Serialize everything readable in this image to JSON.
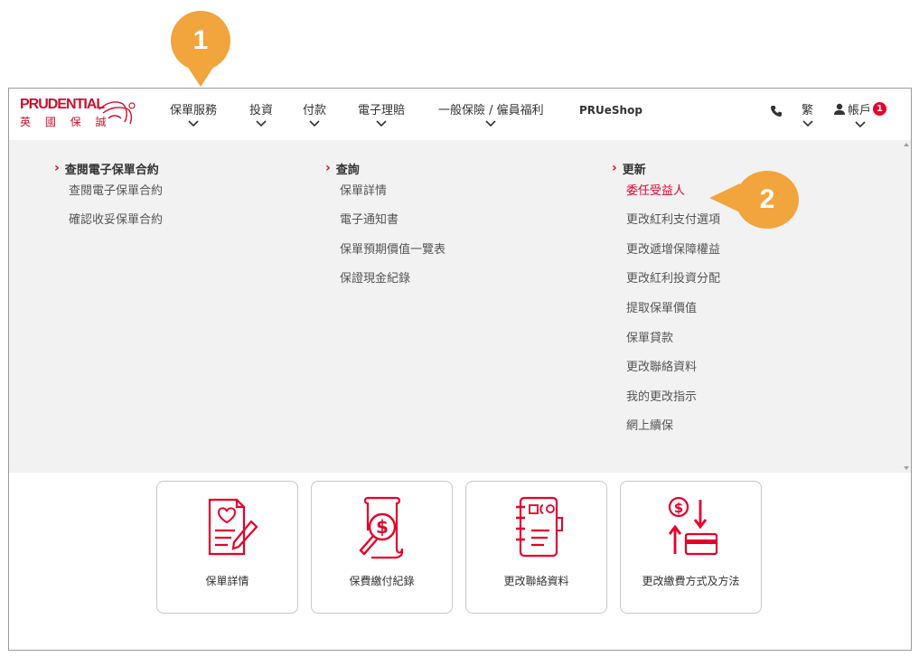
{
  "callouts": [
    "1",
    "2"
  ],
  "logo": {
    "top": "PRUDENTIAL",
    "bottom": "英 國 保 誠"
  },
  "nav": {
    "items": [
      "保單服務",
      "投資",
      "付款",
      "電子理賠",
      "一般保險 / 僱員福利"
    ],
    "shop": "PRUeShop",
    "lang": "繁",
    "account": "帳戶",
    "account_badge": "1"
  },
  "menu": {
    "columns": [
      {
        "heading": "查閱電子保單合約",
        "links": [
          "查閱電子保單合約",
          "確認收妥保單合約"
        ]
      },
      {
        "heading": "查詢",
        "links": [
          "保單詳情",
          "電子通知書",
          "保單預期價值一覽表",
          "保證現金紀錄"
        ]
      },
      {
        "heading": "更新",
        "links": [
          "委任受益人",
          "更改紅利支付選項",
          "更改遞增保障權益",
          "更改紅利投資分配",
          "提取保單價值",
          "保單貸款",
          "更改聯絡資料",
          "我的更改指示",
          "網上續保"
        ]
      }
    ]
  },
  "tiles": [
    {
      "label": "保單詳情",
      "icon": "policy-document-pen-icon"
    },
    {
      "label": "保費繳付紀錄",
      "icon": "payment-record-magnifier-icon"
    },
    {
      "label": "更改聯絡資料",
      "icon": "contact-notebook-icon"
    },
    {
      "label": "更改繳費方式及方法",
      "icon": "payment-method-card-icon"
    }
  ],
  "colors": {
    "brand_red": "#e4002b",
    "callout": "#f2a43d",
    "menu_bg": "#f2f2f2"
  }
}
